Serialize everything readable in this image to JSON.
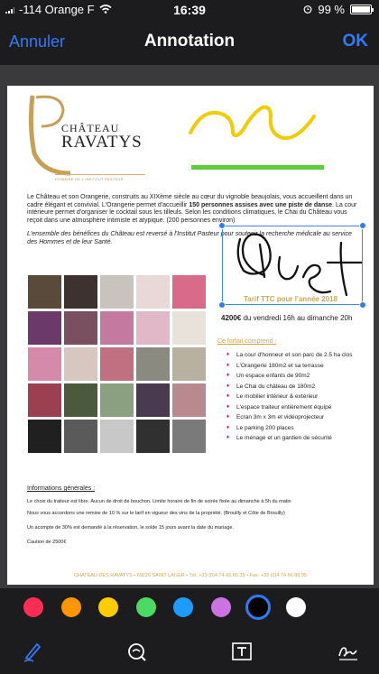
{
  "status": {
    "carrier": "-114 Orange F",
    "time": "16:39",
    "battery_text": "99 %",
    "battery_level": 0.99
  },
  "nav": {
    "cancel": "Annuler",
    "title": "Annotation",
    "ok": "OK"
  },
  "document": {
    "logo_line1": "CHÂTEAU",
    "logo_line2": "RAVATYS",
    "logo_sub": "DOMAINE DE L'INSTITUT PASTEUR",
    "intro_plain1": "Le Château et son Orangerie, construits au XIXème siècle au cœur du vignoble beaujolais, vous accueillent dans un cadre élégant et convivial. L'Orangerie permet d'accueillir ",
    "intro_bold": "150 personnes assises avec une piste de danse",
    "intro_plain2": ". La cour intérieure permet d'organiser le cocktail sous les tilleuls. Selon les conditions climatiques, le Chai du Château vous reçoit dans une atmosphère intimiste et atypique. (200 personnes environ)",
    "benefit": "L'ensemble des bénéfices du Château est reversé à l'Institut Pasteur pour soutenir la recherche médicale au service des Hommes et de leur Santé.",
    "tarif": "Tarif TTC pour l'année 2018",
    "price_bold": "4200€",
    "price_rest": " du vendredi 16h au dimanche 20h",
    "forfait": "Ce forfait comprend :",
    "bullets": [
      "La cour d'honneur et son parc de 2.5 ha clos",
      "L'Orangerie 180m2 et sa terrasse",
      "Un espace enfants de 90m2",
      "Le Chai du château de 180m2",
      "Le mobilier intérieur & extérieur",
      "L'espace traiteur entièrement équipé",
      "Ecran 3m x 3m et vidéoprojecteur",
      "Le parking 200 places",
      "Le ménage et un gardien de sécurité"
    ],
    "info_head": "Informations générales :",
    "info_lines": [
      "Le choix du traiteur est libre.  Aucun de droit de bouchon. Limite horaire de fin de soirée fixée au dimanche à 5h du matin",
      "Nous vous accordons une remise de 10 % sur le tarif en  vigueur des vins de la propriété. (Brouilly et Côte de Brouilly)",
      "Un acompte de 30% est demandé à la réservation, le solde 15 jours avant la date du mariage.",
      "Caution de 2500€"
    ],
    "footer": "CHATEAU DES RAVATYS • 69220  SAINT LAGER • Tél. +33 (0)4 74 66 80 35 • Fax. +33 (0)4 74 66 88 95"
  },
  "palette": [
    {
      "name": "pink",
      "color": "#ff2d55"
    },
    {
      "name": "orange",
      "color": "#ff9500"
    },
    {
      "name": "yellow",
      "color": "#ffcc00"
    },
    {
      "name": "green",
      "color": "#4cd964"
    },
    {
      "name": "blue",
      "color": "#1e9bff"
    },
    {
      "name": "purple",
      "color": "#cc73e1"
    },
    {
      "name": "black",
      "color": "#000000",
      "selected": true
    },
    {
      "name": "white",
      "color": "#ffffff"
    }
  ],
  "tools": [
    {
      "name": "pen-tool-icon"
    },
    {
      "name": "magnifier-tool-icon"
    },
    {
      "name": "text-tool-icon"
    },
    {
      "name": "signature-tool-icon"
    }
  ],
  "colors": {
    "accent": "#2f7cf6",
    "gold": "#d3a64b"
  }
}
